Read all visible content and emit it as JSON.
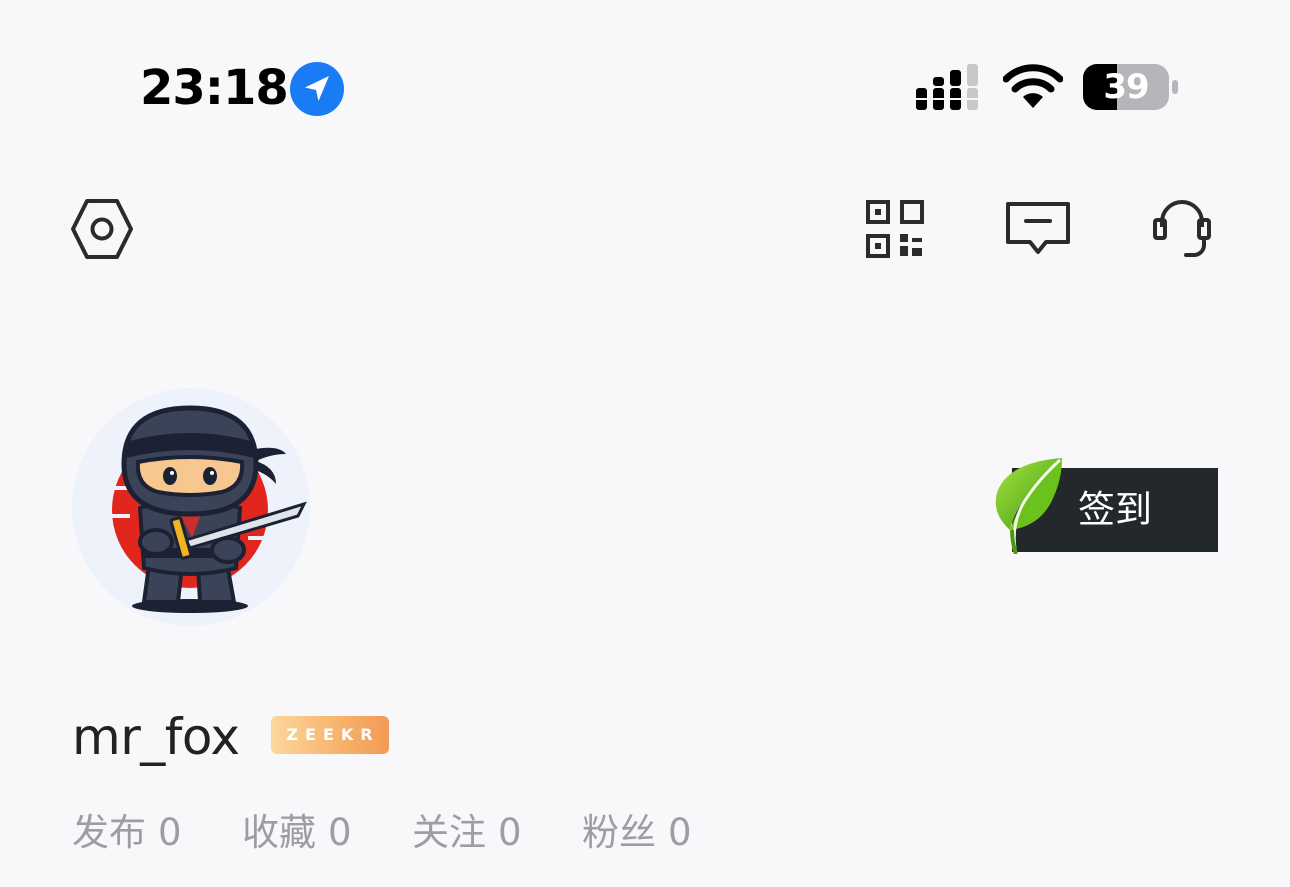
{
  "status_bar": {
    "time": "23:18",
    "battery_level": "39",
    "icons": [
      "location-arrow-icon",
      "cellular-signal-icon",
      "wifi-icon",
      "battery-icon"
    ]
  },
  "toolbar": {
    "icons": [
      "settings-hexagon-icon",
      "qr-code-icon",
      "message-icon",
      "headset-icon"
    ]
  },
  "profile": {
    "avatar": "ninja-avatar",
    "username": "mr_fox",
    "brand_badge": "ZEEKR"
  },
  "checkin": {
    "label": "签到",
    "icon": "leaf-icon"
  },
  "stats": [
    {
      "label": "发布",
      "count": "0"
    },
    {
      "label": "收藏",
      "count": "0"
    },
    {
      "label": "关注",
      "count": "0"
    },
    {
      "label": "粉丝",
      "count": "0"
    }
  ],
  "colors": {
    "background": "#f8f8fb",
    "location_blue": "#1a7cf5",
    "checkin_bg": "#23282b",
    "leaf_green": "#7ed321",
    "badge_gradient_start": "#fbd79c",
    "badge_gradient_end": "#f29a55",
    "stat_text": "#9b9ea3"
  }
}
